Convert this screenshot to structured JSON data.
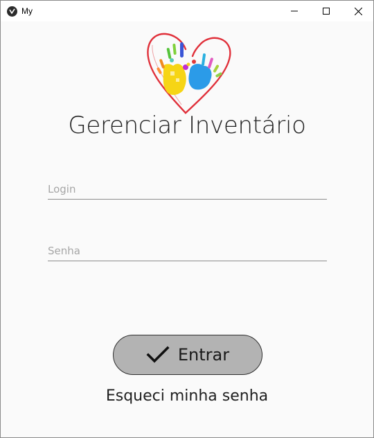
{
  "window": {
    "title": "My",
    "controls": {
      "minimize": "minimize-icon",
      "maximize": "maximize-icon",
      "close": "close-icon"
    }
  },
  "header": {
    "title": "Gerenciar Inventário",
    "logo": "heart-handprint-logo"
  },
  "form": {
    "login_placeholder": "Login",
    "login_value": "",
    "password_placeholder": "Senha",
    "password_value": ""
  },
  "actions": {
    "enter_label": "Entrar",
    "enter_icon": "checkmark-icon",
    "forgot_label": "Esqueci minha senha"
  },
  "colors": {
    "background": "#fafafa",
    "button_fill": "#b3b3b3",
    "heart_outline": "#e0303a",
    "underline": "#8c8c8c"
  }
}
